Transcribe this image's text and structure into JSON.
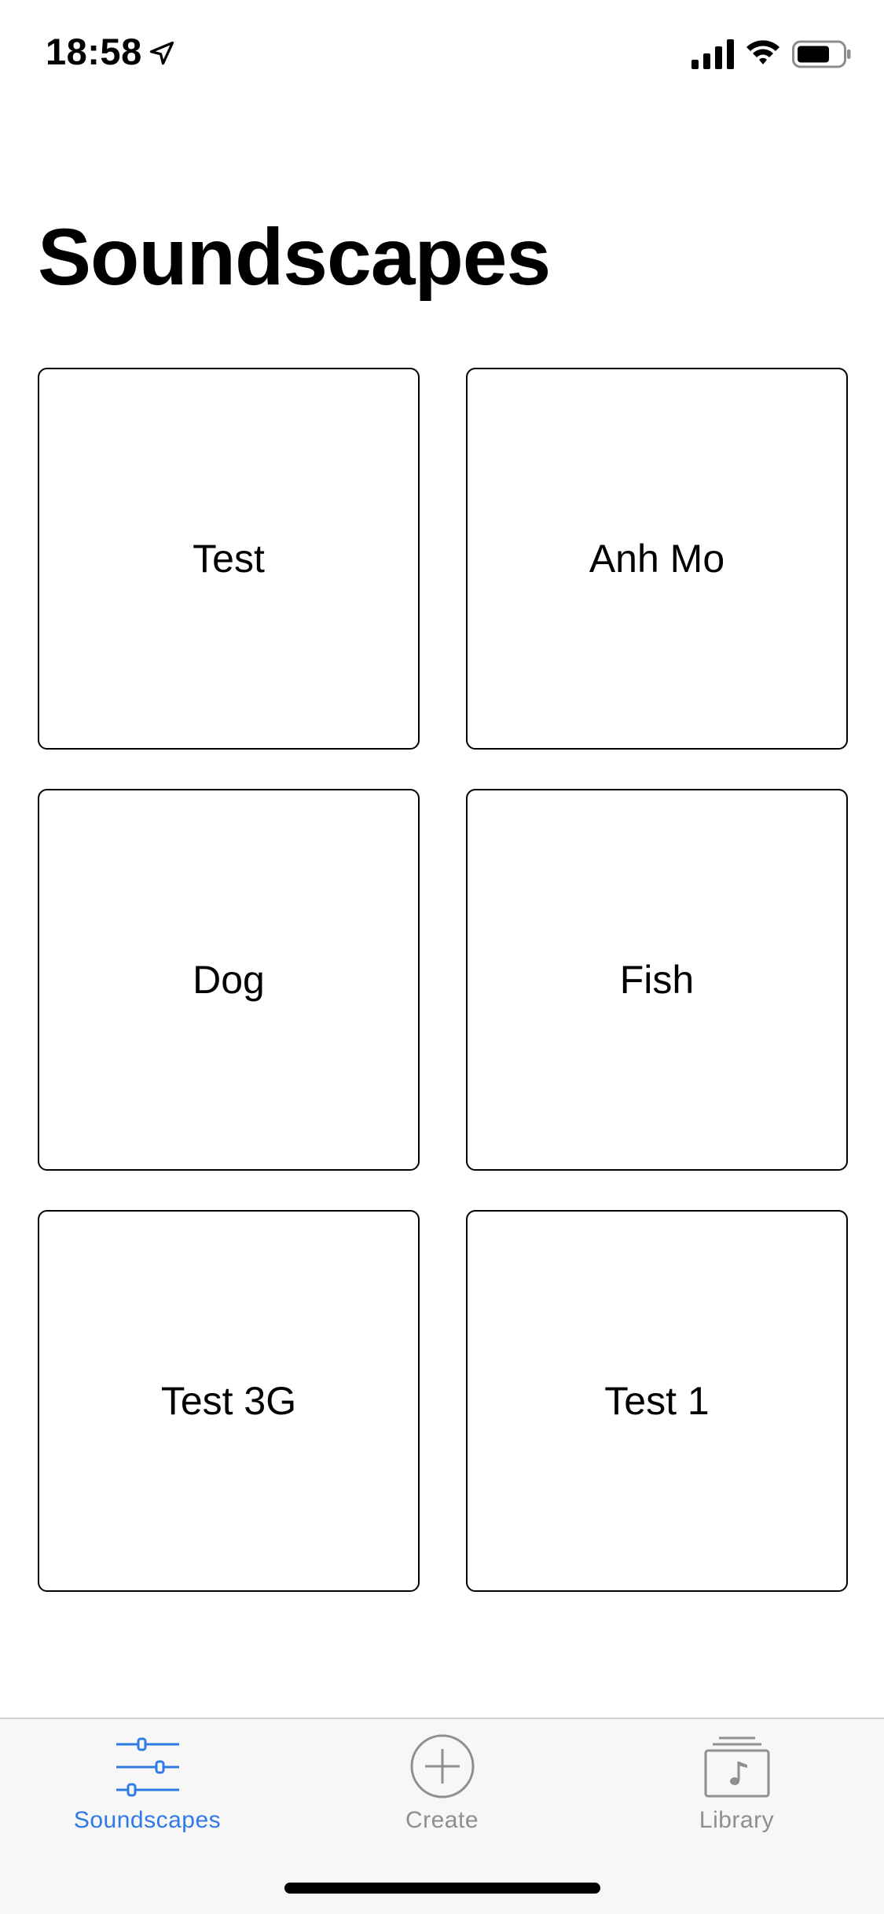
{
  "status_bar": {
    "time": "18:58"
  },
  "header": {
    "title": "Soundscapes"
  },
  "soundscapes": [
    {
      "label": "Test"
    },
    {
      "label": "Anh Mo"
    },
    {
      "label": "Dog"
    },
    {
      "label": "Fish"
    },
    {
      "label": "Test 3G"
    },
    {
      "label": "Test 1"
    }
  ],
  "tab_bar": {
    "tabs": [
      {
        "label": "Soundscapes",
        "icon": "sliders-icon",
        "active": true
      },
      {
        "label": "Create",
        "icon": "plus-circle-icon",
        "active": false
      },
      {
        "label": "Library",
        "icon": "music-library-icon",
        "active": false
      }
    ]
  },
  "colors": {
    "accent": "#2f7ae5",
    "inactive": "#8e8e93",
    "tab_bar_bg": "#f7f7f7"
  }
}
